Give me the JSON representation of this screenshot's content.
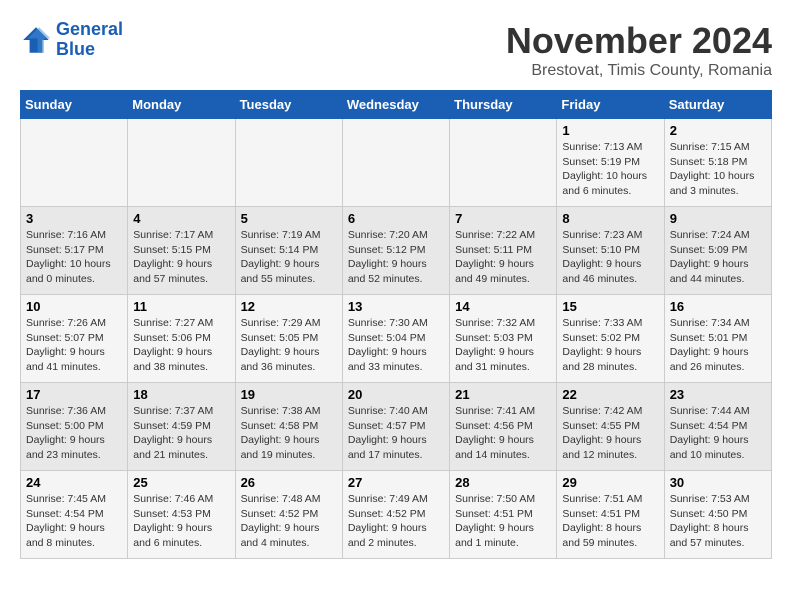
{
  "header": {
    "logo_line1": "General",
    "logo_line2": "Blue",
    "month": "November 2024",
    "location": "Brestovat, Timis County, Romania"
  },
  "weekdays": [
    "Sunday",
    "Monday",
    "Tuesday",
    "Wednesday",
    "Thursday",
    "Friday",
    "Saturday"
  ],
  "weeks": [
    [
      {
        "day": "",
        "info": ""
      },
      {
        "day": "",
        "info": ""
      },
      {
        "day": "",
        "info": ""
      },
      {
        "day": "",
        "info": ""
      },
      {
        "day": "",
        "info": ""
      },
      {
        "day": "1",
        "info": "Sunrise: 7:13 AM\nSunset: 5:19 PM\nDaylight: 10 hours\nand 6 minutes."
      },
      {
        "day": "2",
        "info": "Sunrise: 7:15 AM\nSunset: 5:18 PM\nDaylight: 10 hours\nand 3 minutes."
      }
    ],
    [
      {
        "day": "3",
        "info": "Sunrise: 7:16 AM\nSunset: 5:17 PM\nDaylight: 10 hours\nand 0 minutes."
      },
      {
        "day": "4",
        "info": "Sunrise: 7:17 AM\nSunset: 5:15 PM\nDaylight: 9 hours\nand 57 minutes."
      },
      {
        "day": "5",
        "info": "Sunrise: 7:19 AM\nSunset: 5:14 PM\nDaylight: 9 hours\nand 55 minutes."
      },
      {
        "day": "6",
        "info": "Sunrise: 7:20 AM\nSunset: 5:12 PM\nDaylight: 9 hours\nand 52 minutes."
      },
      {
        "day": "7",
        "info": "Sunrise: 7:22 AM\nSunset: 5:11 PM\nDaylight: 9 hours\nand 49 minutes."
      },
      {
        "day": "8",
        "info": "Sunrise: 7:23 AM\nSunset: 5:10 PM\nDaylight: 9 hours\nand 46 minutes."
      },
      {
        "day": "9",
        "info": "Sunrise: 7:24 AM\nSunset: 5:09 PM\nDaylight: 9 hours\nand 44 minutes."
      }
    ],
    [
      {
        "day": "10",
        "info": "Sunrise: 7:26 AM\nSunset: 5:07 PM\nDaylight: 9 hours\nand 41 minutes."
      },
      {
        "day": "11",
        "info": "Sunrise: 7:27 AM\nSunset: 5:06 PM\nDaylight: 9 hours\nand 38 minutes."
      },
      {
        "day": "12",
        "info": "Sunrise: 7:29 AM\nSunset: 5:05 PM\nDaylight: 9 hours\nand 36 minutes."
      },
      {
        "day": "13",
        "info": "Sunrise: 7:30 AM\nSunset: 5:04 PM\nDaylight: 9 hours\nand 33 minutes."
      },
      {
        "day": "14",
        "info": "Sunrise: 7:32 AM\nSunset: 5:03 PM\nDaylight: 9 hours\nand 31 minutes."
      },
      {
        "day": "15",
        "info": "Sunrise: 7:33 AM\nSunset: 5:02 PM\nDaylight: 9 hours\nand 28 minutes."
      },
      {
        "day": "16",
        "info": "Sunrise: 7:34 AM\nSunset: 5:01 PM\nDaylight: 9 hours\nand 26 minutes."
      }
    ],
    [
      {
        "day": "17",
        "info": "Sunrise: 7:36 AM\nSunset: 5:00 PM\nDaylight: 9 hours\nand 23 minutes."
      },
      {
        "day": "18",
        "info": "Sunrise: 7:37 AM\nSunset: 4:59 PM\nDaylight: 9 hours\nand 21 minutes."
      },
      {
        "day": "19",
        "info": "Sunrise: 7:38 AM\nSunset: 4:58 PM\nDaylight: 9 hours\nand 19 minutes."
      },
      {
        "day": "20",
        "info": "Sunrise: 7:40 AM\nSunset: 4:57 PM\nDaylight: 9 hours\nand 17 minutes."
      },
      {
        "day": "21",
        "info": "Sunrise: 7:41 AM\nSunset: 4:56 PM\nDaylight: 9 hours\nand 14 minutes."
      },
      {
        "day": "22",
        "info": "Sunrise: 7:42 AM\nSunset: 4:55 PM\nDaylight: 9 hours\nand 12 minutes."
      },
      {
        "day": "23",
        "info": "Sunrise: 7:44 AM\nSunset: 4:54 PM\nDaylight: 9 hours\nand 10 minutes."
      }
    ],
    [
      {
        "day": "24",
        "info": "Sunrise: 7:45 AM\nSunset: 4:54 PM\nDaylight: 9 hours\nand 8 minutes."
      },
      {
        "day": "25",
        "info": "Sunrise: 7:46 AM\nSunset: 4:53 PM\nDaylight: 9 hours\nand 6 minutes."
      },
      {
        "day": "26",
        "info": "Sunrise: 7:48 AM\nSunset: 4:52 PM\nDaylight: 9 hours\nand 4 minutes."
      },
      {
        "day": "27",
        "info": "Sunrise: 7:49 AM\nSunset: 4:52 PM\nDaylight: 9 hours\nand 2 minutes."
      },
      {
        "day": "28",
        "info": "Sunrise: 7:50 AM\nSunset: 4:51 PM\nDaylight: 9 hours\nand 1 minute."
      },
      {
        "day": "29",
        "info": "Sunrise: 7:51 AM\nSunset: 4:51 PM\nDaylight: 8 hours\nand 59 minutes."
      },
      {
        "day": "30",
        "info": "Sunrise: 7:53 AM\nSunset: 4:50 PM\nDaylight: 8 hours\nand 57 minutes."
      }
    ]
  ]
}
